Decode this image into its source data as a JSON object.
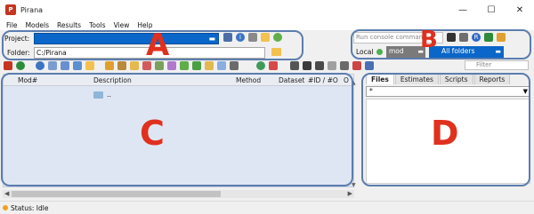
{
  "window": {
    "title": "Pirana",
    "controls": {
      "minimize": "—",
      "maximize": "☐",
      "close": "✕"
    }
  },
  "menu": [
    "File",
    "Models",
    "Results",
    "Tools",
    "View",
    "Help"
  ],
  "project": {
    "label": "Project:",
    "value": ""
  },
  "folder": {
    "label": "Folder:",
    "value": "C:/Pirana"
  },
  "console": {
    "placeholder": "Run console command"
  },
  "local": {
    "label": "Local",
    "mod_value": "mod",
    "folders_value": "All folders"
  },
  "toolbar": {
    "filter_placeholder": "Filter"
  },
  "grid": {
    "columns": [
      "Mod#",
      "Description",
      "Method",
      "Dataset",
      "#ID / #O",
      "O"
    ],
    "parent_label": ".."
  },
  "right_panel": {
    "tabs": [
      "Files",
      "Estimates",
      "Scripts",
      "Reports"
    ],
    "active_tab": "Files",
    "filter_value": "*"
  },
  "status": {
    "text": "Status: Idle"
  },
  "annotations": [
    "A",
    "B",
    "C",
    "D"
  ],
  "colors": {
    "accent": "#0a66c8",
    "annotation_letter": "#e0301e",
    "annotation_box": "#5b7dae"
  }
}
